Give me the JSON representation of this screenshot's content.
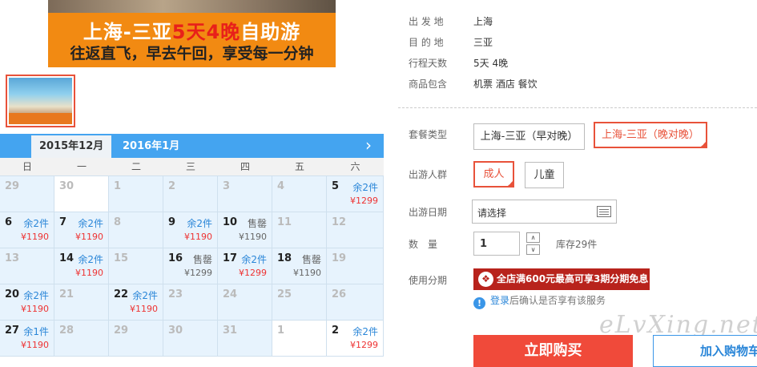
{
  "banner": {
    "title_pre": "上海-三亚",
    "title_highlight": "5天4晚",
    "title_post": "自助游",
    "subtitle": "往返直飞，早去午回，享受每一分钟"
  },
  "calendar": {
    "tabs": [
      "2015年12月",
      "2016年1月"
    ],
    "next_icon": "chevron-right-icon",
    "weekdays": [
      "日",
      "一",
      "二",
      "三",
      "四",
      "五",
      "六"
    ],
    "rows": [
      [
        {
          "day": "29",
          "off": true,
          "white": false
        },
        {
          "day": "30",
          "off": true,
          "white": true
        },
        {
          "day": "1",
          "off": true,
          "white": false
        },
        {
          "day": "2",
          "off": true,
          "white": false
        },
        {
          "day": "3",
          "off": true,
          "white": false
        },
        {
          "day": "4",
          "off": true,
          "white": false
        },
        {
          "day": "5",
          "stock": "余2件",
          "price": "¥1299"
        }
      ],
      [
        {
          "day": "6",
          "stock": "余2件",
          "price": "¥1190"
        },
        {
          "day": "7",
          "stock": "余2件",
          "price": "¥1190"
        },
        {
          "day": "8",
          "off": true
        },
        {
          "day": "9",
          "stock": "余2件",
          "price": "¥1190"
        },
        {
          "day": "10",
          "stock": "售罄",
          "price": "¥1190",
          "sold": true
        },
        {
          "day": "11",
          "off": true
        },
        {
          "day": "12",
          "off": true
        }
      ],
      [
        {
          "day": "13",
          "off": true
        },
        {
          "day": "14",
          "stock": "余2件",
          "price": "¥1190"
        },
        {
          "day": "15",
          "off": true
        },
        {
          "day": "16",
          "stock": "售罄",
          "price": "¥1299",
          "sold": true
        },
        {
          "day": "17",
          "stock": "余2件",
          "price": "¥1299"
        },
        {
          "day": "18",
          "stock": "售罄",
          "price": "¥1190",
          "sold": true
        },
        {
          "day": "19",
          "off": true
        }
      ],
      [
        {
          "day": "20",
          "stock": "余2件",
          "price": "¥1190"
        },
        {
          "day": "21",
          "off": true
        },
        {
          "day": "22",
          "stock": "余2件",
          "price": "¥1190"
        },
        {
          "day": "23",
          "off": true
        },
        {
          "day": "24",
          "off": true
        },
        {
          "day": "25",
          "off": true
        },
        {
          "day": "26",
          "off": true
        }
      ],
      [
        {
          "day": "27",
          "stock": "余1件",
          "price": "¥1190"
        },
        {
          "day": "28",
          "off": true
        },
        {
          "day": "29",
          "off": true
        },
        {
          "day": "30",
          "off": true
        },
        {
          "day": "31",
          "off": true
        },
        {
          "day": "1",
          "off": true,
          "white": true
        },
        {
          "day": "2",
          "stock": "余2件",
          "price": "¥1299",
          "white": true
        }
      ]
    ]
  },
  "info": {
    "rows": [
      {
        "label": "出 发 地",
        "value": "上海"
      },
      {
        "label": "目 的 地",
        "value": "三亚"
      },
      {
        "label": "行程天数",
        "value": "5天 4晚"
      },
      {
        "label": "商品包含",
        "value": "机票   酒店   餐饮"
      }
    ]
  },
  "options": {
    "package_label": "套餐类型",
    "packages": [
      "上海-三亚（早对晚）",
      "上海-三亚（晚对晚）"
    ],
    "crowd_label": "出游人群",
    "crowds": [
      "成人",
      "儿童"
    ],
    "date_label": "出游日期",
    "date_value": "请选择",
    "qty_label": "数　量",
    "qty_value": "1",
    "stock_text": "库存29件",
    "installment_label": "使用分期",
    "promo_text": "全店满600元最高可享3期分期免息",
    "login_link": "登录",
    "login_text": "后确认是否享有该服务"
  },
  "actions": {
    "buy": "立即购买",
    "cart": "加入购物车"
  },
  "watermark": "eLvXing.net",
  "colors": {
    "accent": "#f04a3a",
    "blue": "#44a4f0",
    "promo": "#b8231c"
  }
}
